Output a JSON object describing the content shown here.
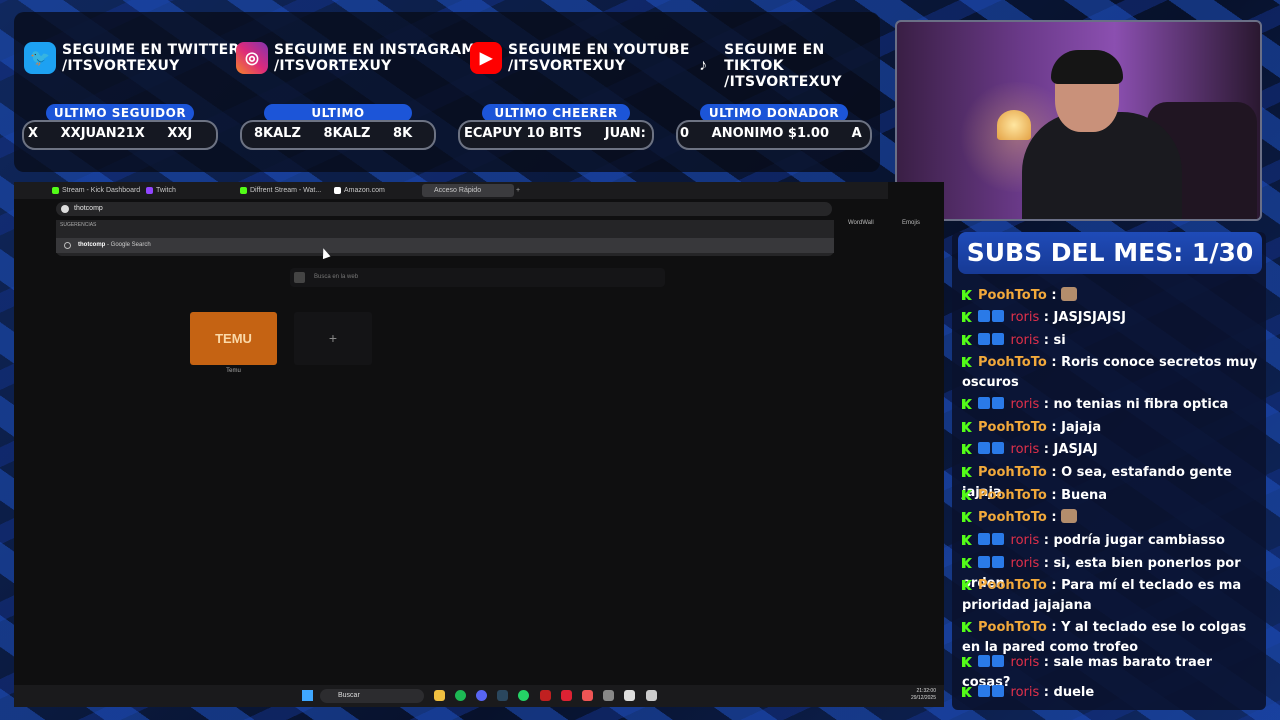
{
  "socials": [
    {
      "icon": "twitter-icon",
      "color": "#1da1f2",
      "line1": "SEGUIME EN TWITTER",
      "line2": "/ITSVORTEXUY"
    },
    {
      "icon": "instagram-icon",
      "color": "#d6249f",
      "line1": "SEGUIME EN INSTAGRAM",
      "line2": "/ITSVORTEXUY"
    },
    {
      "icon": "youtube-icon",
      "color": "#ff0000",
      "line1": "SEGUIME EN YOUTUBE",
      "line2": "/ITSVORTEXUY"
    },
    {
      "icon": "tiktok-icon",
      "color": "#000000",
      "line1": "SEGUIME EN TIKTOK",
      "line2": "/ITSVORTEXUY"
    }
  ],
  "stats": [
    {
      "label": "ULTIMO SEGUIDOR",
      "value": "X     XXJUAN21X     XXJ"
    },
    {
      "label": "ULTIMO SUSCRIPTOR",
      "value": "8KALZ     8KALZ     8K"
    },
    {
      "label": "ULTIMO CHEERER",
      "value": "ECAPUY 10 BITS     JUAN:"
    },
    {
      "label": "ULTIMO DONADOR",
      "value": "0     ANONIMO $1.00     A"
    }
  ],
  "browser": {
    "tabs": [
      {
        "label": "Stream - Kick Dashboard",
        "color": "#53fc18"
      },
      {
        "label": "Twitch",
        "color": "#9146ff"
      },
      {
        "label": "Diffrent Stream - Wat...",
        "color": "#53fc18"
      },
      {
        "label": "Amazon.com",
        "color": "#ffffff"
      },
      {
        "label": "Acceso Rápido",
        "color": "#888888"
      }
    ],
    "address_value": "thotcomp",
    "suggestions_label": "SUGERENCIAS",
    "suggestion_bold": "thotcomp",
    "suggestion_rest": " - Google Search",
    "search_web_placeholder": "Busca en la web",
    "tile_logo": "TEMU",
    "tile_label": "Temu",
    "add_tile": "+",
    "bookmarks": [
      "WordWall",
      "Emojis"
    ]
  },
  "taskbar": {
    "search_label": "Buscar",
    "time": "21:32:00",
    "date": "29/12/2025"
  },
  "subs_title": "SUBS DEL MES: 1/30",
  "chat": [
    {
      "user": "PoohToTo",
      "style": "pooh",
      "badges": false,
      "text": "",
      "emote": true
    },
    {
      "user": "roris",
      "style": "roris",
      "badges": true,
      "text": "JASJSJAJSJ",
      "emote": false
    },
    {
      "user": "roris",
      "style": "roris",
      "badges": true,
      "text": "si",
      "emote": false
    },
    {
      "user": "PoohToTo",
      "style": "pooh",
      "badges": false,
      "text": "Roris conoce secretos muy oscuros",
      "emote": false
    },
    {
      "user": "roris",
      "style": "roris",
      "badges": true,
      "text": "no tenias ni fibra optica",
      "emote": false
    },
    {
      "user": "PoohToTo",
      "style": "pooh",
      "badges": false,
      "text": "Jajaja",
      "emote": false
    },
    {
      "user": "roris",
      "style": "roris",
      "badges": true,
      "text": "JASJAJ",
      "emote": false
    },
    {
      "user": "PoohToTo",
      "style": "pooh",
      "badges": false,
      "text": "O sea, estafando gente jajaja",
      "emote": false
    },
    {
      "user": "PoohToTo",
      "style": "pooh",
      "badges": false,
      "text": "Buena",
      "emote": false
    },
    {
      "user": "PoohToTo",
      "style": "pooh",
      "badges": false,
      "text": "",
      "emote": true
    },
    {
      "user": "roris",
      "style": "roris",
      "badges": true,
      "text": "podría jugar cambiasso",
      "emote": false
    },
    {
      "user": "roris",
      "style": "roris",
      "badges": true,
      "text": "si, esta bien ponerlos por orden",
      "emote": false
    },
    {
      "user": "PoohToTo",
      "style": "pooh",
      "badges": false,
      "text": "Para mí el teclado es ma prioridad jajajana",
      "emote": false
    },
    {
      "user": "PoohToTo",
      "style": "pooh",
      "badges": false,
      "text": "Y al teclado ese lo colgas en la pared como trofeo",
      "emote": false
    },
    {
      "user": "roris",
      "style": "roris",
      "badges": true,
      "text": "sale mas barato traer cosas?",
      "emote": false
    },
    {
      "user": "roris",
      "style": "roris",
      "badges": true,
      "text": "duele",
      "emote": false
    }
  ]
}
